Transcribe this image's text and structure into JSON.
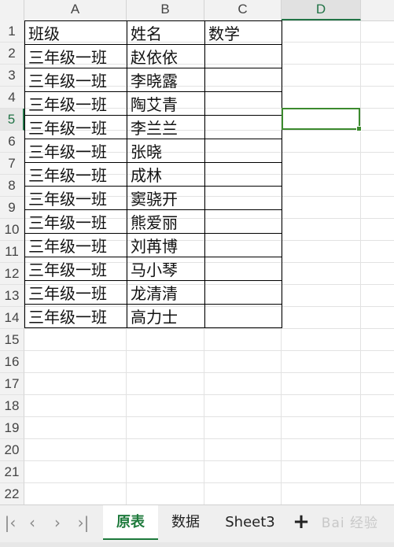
{
  "columns": [
    "A",
    "B",
    "C",
    "D"
  ],
  "rows": [
    "1",
    "2",
    "3",
    "4",
    "5",
    "6",
    "7",
    "8",
    "9",
    "10",
    "11",
    "12",
    "13",
    "14",
    "15",
    "16",
    "17",
    "18",
    "19",
    "20",
    "21",
    "22"
  ],
  "table": [
    [
      "班级",
      "姓名",
      "数学"
    ],
    [
      "三年级一班",
      "赵依依",
      ""
    ],
    [
      "三年级一班",
      "李晓露",
      ""
    ],
    [
      "三年级一班",
      "陶艾青",
      ""
    ],
    [
      "三年级一班",
      "李兰兰",
      ""
    ],
    [
      "三年级一班",
      "张晓",
      ""
    ],
    [
      "三年级一班",
      "成林",
      ""
    ],
    [
      "三年级一班",
      "窦骁开",
      ""
    ],
    [
      "三年级一班",
      "熊爱丽",
      ""
    ],
    [
      "三年级一班",
      "刘苒博",
      ""
    ],
    [
      "三年级一班",
      "马小琴",
      ""
    ],
    [
      "三年级一班",
      "龙清清",
      ""
    ],
    [
      "三年级一班",
      "高力士",
      ""
    ]
  ],
  "active_cell": {
    "column": "D",
    "row": "5"
  },
  "sheet_tabs": [
    "原表",
    "数据",
    "Sheet3"
  ],
  "active_tab": "原表",
  "nav_icons": [
    "first-sheet-icon",
    "prev-sheet-icon",
    "next-sheet-icon",
    "last-sheet-icon"
  ],
  "watermark": "Bai 经验",
  "colors": {
    "accent": "#217346",
    "selection": "#3c8a2e"
  }
}
